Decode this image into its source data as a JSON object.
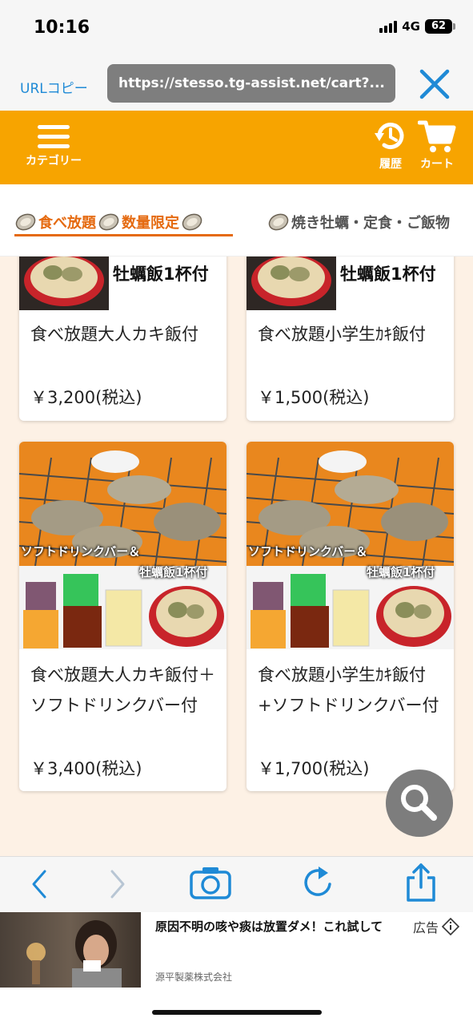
{
  "status_bar": {
    "time": "10:16",
    "network": "4G",
    "battery": "62"
  },
  "browser": {
    "url_copy_label": "URLコピー",
    "url": "https://stesso.tg-assist.net/cart?...",
    "close_icon": "close-icon"
  },
  "header": {
    "menu_label": "カテゴリー",
    "history_label": "履歴",
    "cart_label": "カート",
    "brand_color": "#f7a400"
  },
  "tabs": [
    {
      "label": "食べ放題",
      "active": true
    },
    {
      "label": "数量限定",
      "active": true
    },
    {
      "label": "焼き牡蠣・定食・ご飯物",
      "active": false
    }
  ],
  "products": [
    {
      "name": "食べ放題大人カキ飯付",
      "price": "￥3,200(税込)",
      "banner": "牡蠣飯1杯付"
    },
    {
      "name": "食べ放題小学生ｶｷ飯付",
      "price": "￥1,500(税込)",
      "banner": "牡蠣飯1杯付"
    },
    {
      "name": "食べ放題大人カキ飯付＋ソフトドリンクバー付",
      "price": "￥3,400(税込)",
      "overlay1": "ソフトドリンクバー＆",
      "overlay2": "牡蠣飯1杯付"
    },
    {
      "name": "食べ放題小学生ｶｷ飯付+ソフトドリンクバー付",
      "price": "￥1,700(税込)",
      "overlay1": "ソフトドリンクバー＆",
      "overlay2": "牡蠣飯1杯付"
    }
  ],
  "ad": {
    "text": "原因不明の咳や痰は放置ダメ！これ試して",
    "company": "源平製薬株式会社",
    "label": "広告"
  },
  "colors": {
    "accent": "#e56a10",
    "link": "#1f8ad6",
    "background": "#fdf1e5"
  }
}
